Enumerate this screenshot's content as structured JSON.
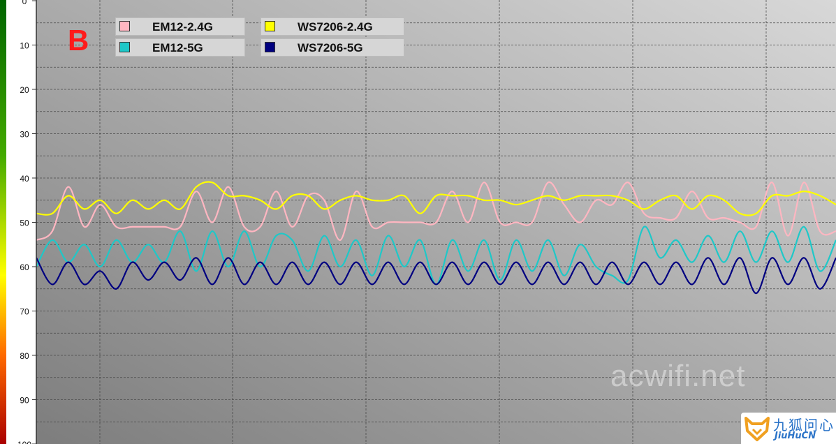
{
  "panel_label": "B",
  "watermark": "acwifi.net",
  "logo": {
    "cn": "九狐问心",
    "en": "JiuHuCN"
  },
  "chart_data": {
    "type": "line",
    "title": "",
    "xlabel": "",
    "ylabel": "",
    "ylim": [
      0,
      100
    ],
    "y_inverted": true,
    "yticks": [
      0,
      10,
      20,
      30,
      40,
      50,
      60,
      70,
      80,
      90,
      100
    ],
    "ytick_labels": [
      "0",
      "10",
      "20",
      "30",
      "40",
      "50",
      "60",
      "70",
      "80",
      "90",
      "100"
    ],
    "xlim": [
      0,
      100
    ],
    "grid": true,
    "legend_position": "top-left",
    "x": [
      0,
      2,
      4,
      6,
      8,
      10,
      12,
      14,
      16,
      18,
      20,
      22,
      24,
      26,
      28,
      30,
      32,
      34,
      36,
      38,
      40,
      42,
      44,
      46,
      48,
      50,
      52,
      54,
      56,
      58,
      60,
      62,
      64,
      66,
      68,
      70,
      72,
      74,
      76,
      78,
      80,
      82,
      84,
      86,
      88,
      90,
      92,
      94,
      96,
      98,
      100
    ],
    "series": [
      {
        "name": "EM12-2.4G",
        "color": "#ffb6c1",
        "values": [
          54,
          52,
          42,
          51,
          46,
          51,
          51,
          51,
          51,
          51,
          43,
          50,
          42,
          51,
          51,
          43,
          51,
          44,
          45,
          54,
          43,
          51,
          50,
          50,
          50,
          50,
          43,
          50,
          41,
          50,
          50,
          50,
          41,
          46,
          50,
          45,
          46,
          41,
          48,
          49,
          49,
          43,
          49,
          49,
          50,
          51,
          41,
          53,
          41,
          52,
          52
        ]
      },
      {
        "name": "WS7206-2.4G",
        "color": "#ffff00",
        "values": [
          48,
          48,
          44,
          47,
          45,
          48,
          45,
          47,
          45,
          47,
          42,
          41,
          44,
          44,
          45,
          47,
          44,
          44,
          47,
          45,
          44,
          45,
          45,
          44,
          48,
          44,
          44,
          44,
          45,
          45,
          46,
          45,
          44,
          45,
          44,
          44,
          44,
          45,
          47,
          45,
          44,
          47,
          44,
          45,
          48,
          48,
          44,
          44,
          43,
          44,
          46
        ]
      },
      {
        "name": "EM12-5G",
        "color": "#1ec8c8",
        "values": [
          60,
          54,
          59,
          55,
          60,
          54,
          59,
          55,
          59,
          52,
          61,
          52,
          60,
          52,
          60,
          53,
          54,
          61,
          53,
          60,
          54,
          62,
          53,
          60,
          54,
          64,
          54,
          61,
          54,
          63,
          54,
          61,
          54,
          62,
          55,
          60,
          62,
          63,
          51,
          58,
          54,
          59,
          53,
          59,
          52,
          59,
          52,
          59,
          51,
          61,
          54
        ]
      },
      {
        "name": "WS7206-5G",
        "color": "#000080",
        "values": [
          58,
          64,
          59,
          64,
          61,
          65,
          59,
          63,
          59,
          63,
          58,
          64,
          58,
          64,
          59,
          64,
          59,
          64,
          59,
          64,
          59,
          64,
          59,
          64,
          59,
          64,
          59,
          64,
          59,
          64,
          59,
          64,
          59,
          64,
          59,
          64,
          59,
          64,
          59,
          64,
          59,
          64,
          58,
          64,
          58,
          66,
          58,
          64,
          58,
          65,
          58
        ]
      }
    ]
  }
}
